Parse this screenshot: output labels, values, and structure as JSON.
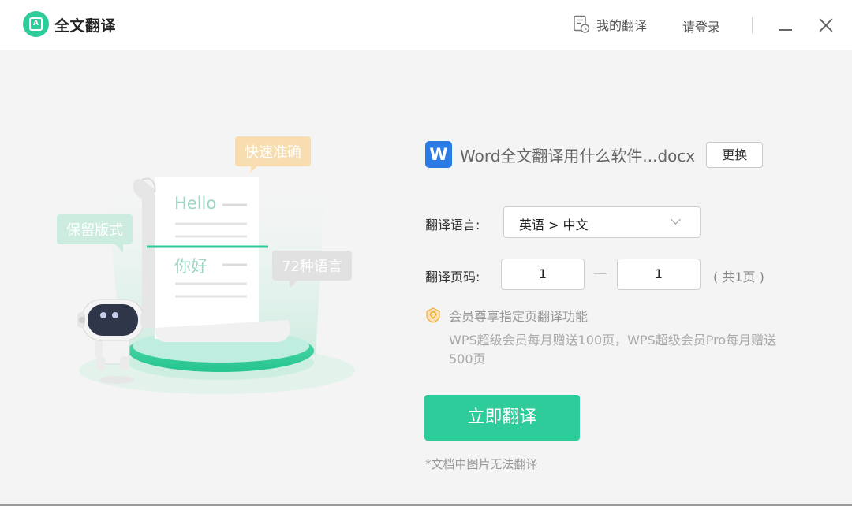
{
  "app": {
    "title": "全文翻译",
    "logo_glyph": "A",
    "accent": "#2ecc9a"
  },
  "titlebar": {
    "my_translations": "我的翻译",
    "login": "请登录",
    "icons": [
      "document-clock-icon",
      "minimize-icon",
      "close-icon"
    ]
  },
  "illustration": {
    "bubble_fast": "快速准确",
    "bubble_layout": "保留版式",
    "bubble_langs": "72种语言",
    "text_hello": "Hello",
    "text_nihao": "你好"
  },
  "file": {
    "icon_letter": "W",
    "name": "Word全文翻译用什么软件...docx",
    "replace_label": "更换"
  },
  "form": {
    "lang_label": "翻译语言:",
    "lang_value": "英语 > 中文",
    "page_label": "翻译页码:",
    "page_from": "1",
    "page_to": "1",
    "page_total": "( 共1页 )"
  },
  "vip": {
    "title": "会员尊享指定页翻译功能",
    "desc": "WPS超级会员每月赠送100页，WPS超级会员Pro每月赠送500页"
  },
  "actions": {
    "translate_label": "立即翻译"
  },
  "note": "*文档中图片无法翻译"
}
